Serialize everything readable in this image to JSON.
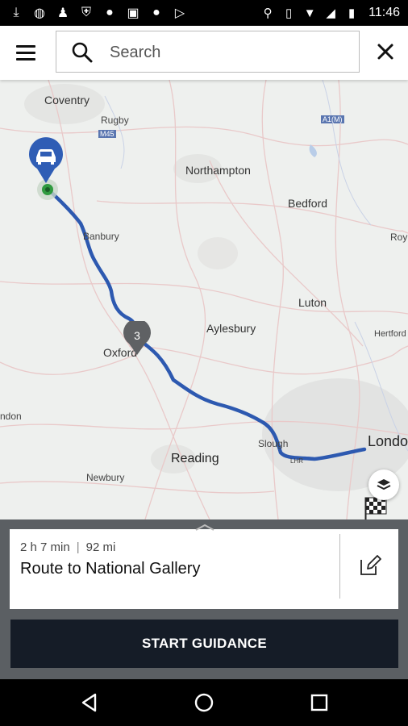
{
  "status_bar": {
    "time": "11:46",
    "left_icons": [
      "download-icon",
      "basketball-icon",
      "person-icon",
      "shield-icon",
      "circle-icon",
      "image-icon",
      "circle-icon",
      "play-store-icon"
    ],
    "right_icons": [
      "location-icon",
      "vibrate-icon",
      "wifi-icon",
      "signal-icon",
      "battery-icon"
    ]
  },
  "header": {
    "search_placeholder": "Search"
  },
  "map": {
    "places": {
      "coventry": "Coventry",
      "rugby": "Rugby",
      "northampton": "Northampton",
      "bedford": "Bedford",
      "banbury": "Banbury",
      "royston": "Roy",
      "luton": "Luton",
      "aylesbury": "Aylesbury",
      "oxford": "Oxford",
      "hertford": "Hertford",
      "london_west": "ndon",
      "slough": "Slough",
      "reading": "Reading",
      "newbury": "Newbury",
      "london": "London",
      "lhr": "LHR",
      "m45": "M45",
      "a1m": "A1(M)"
    },
    "waypoint_number": "3",
    "accent_color": "#2f5db5",
    "route_color": "#2d59b0"
  },
  "route_card": {
    "duration": "2 h 7 min",
    "distance": "92 mi",
    "title": "Route to National Gallery"
  },
  "actions": {
    "start_label": "START GUIDANCE"
  }
}
